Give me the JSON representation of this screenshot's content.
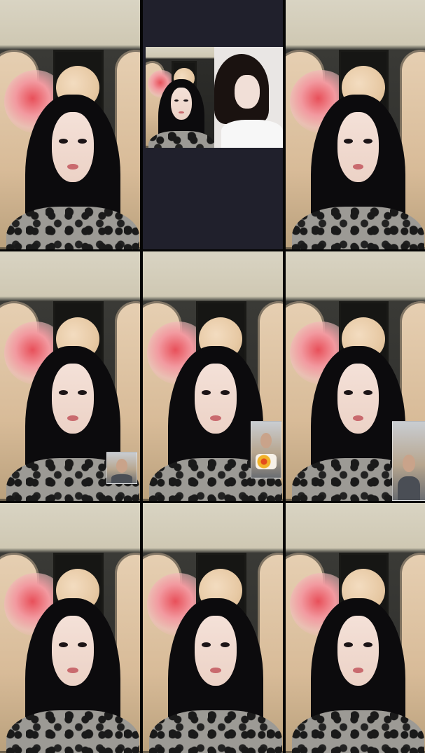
{
  "layout": {
    "columns": 3,
    "rows": 3
  },
  "tiles": [
    {
      "type": "selfie",
      "hand_raised": false
    },
    {
      "type": "call",
      "participants": 2
    },
    {
      "type": "selfie",
      "hand_raised": false
    },
    {
      "type": "selfie_with_pip",
      "pip": "man"
    },
    {
      "type": "selfie_with_pip",
      "pip": "man_with_food"
    },
    {
      "type": "selfie_with_pip",
      "pip": "man",
      "hand_raised": true
    },
    {
      "type": "selfie",
      "hand_raised": false
    },
    {
      "type": "selfie",
      "hand_raised": false
    },
    {
      "type": "selfie",
      "hands_on_head": true
    }
  ],
  "colors": {
    "call_background": "#20202c",
    "grid_gap": "#050505",
    "panel_cream": "#e7c9a4",
    "flower_red": "#e8505a"
  }
}
